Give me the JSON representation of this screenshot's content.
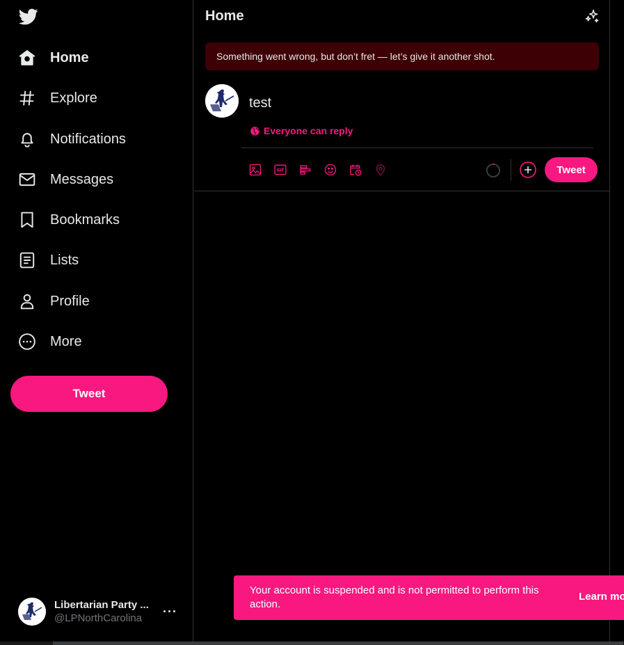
{
  "nav": {
    "items": [
      {
        "label": "Home",
        "icon": "home-icon",
        "active": true
      },
      {
        "label": "Explore",
        "icon": "hashtag-icon"
      },
      {
        "label": "Notifications",
        "icon": "bell-icon"
      },
      {
        "label": "Messages",
        "icon": "envelope-icon"
      },
      {
        "label": "Bookmarks",
        "icon": "bookmark-icon"
      },
      {
        "label": "Lists",
        "icon": "list-icon"
      },
      {
        "label": "Profile",
        "icon": "person-icon"
      },
      {
        "label": "More",
        "icon": "more-circle-icon"
      }
    ],
    "tweet_label": "Tweet"
  },
  "account": {
    "name": "Libertarian Party ...",
    "handle": "@LPNorthCarolina",
    "more_label": "···"
  },
  "header": {
    "title": "Home"
  },
  "error_banner": {
    "text": "Something went wrong, but don’t fret — let’s give it another shot."
  },
  "composer": {
    "text": "test",
    "reply_setting": "Everyone can reply",
    "tweet_label": "Tweet",
    "tools": [
      "image-icon",
      "gif-icon",
      "poll-icon",
      "emoji-icon",
      "schedule-icon",
      "location-icon"
    ]
  },
  "toast": {
    "message": "Your account is suspended and is not permitted to perform this action.",
    "link": "Learn more"
  },
  "colors": {
    "accent": "#f91880",
    "error_bg": "#3d0105",
    "border": "#2f3336",
    "text": "#e7e9ea",
    "muted": "#71767b"
  }
}
